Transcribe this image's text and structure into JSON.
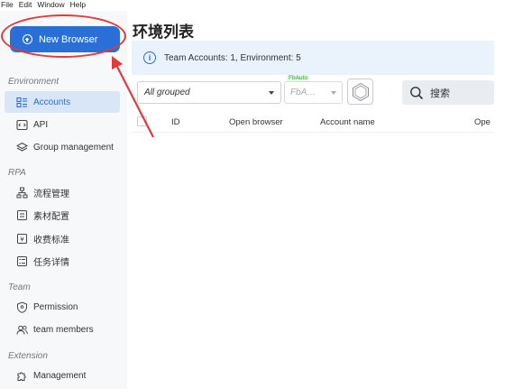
{
  "menu": [
    "File",
    "Edit",
    "Window",
    "Help"
  ],
  "new_browser": "New Browser",
  "sidebar": {
    "environment_label": "Environment",
    "rpa_label": "RPA",
    "team_label": "Team",
    "extension_label": "Extension",
    "items": {
      "accounts": "Accounts",
      "api": "API",
      "group_management": "Group management",
      "process": "流程管理",
      "material": "素材配置",
      "fee": "收费标准",
      "task": "任务详情",
      "permission": "Permission",
      "team_members": "team members",
      "management": "Management"
    }
  },
  "main": {
    "title": "环境列表",
    "info": "Team Accounts: 1, Environment: 5",
    "group_select": "All grouped",
    "fb_select": "FbA…",
    "fb_tag": "FbAuto",
    "rpa": "RPA",
    "search": "搜索",
    "columns": [
      "ID",
      "Open browser",
      "Account name",
      "Ope"
    ]
  },
  "colors": {
    "accent": "#2a6fd8",
    "annotation": "#e03a3a",
    "active_bg": "#d9e6f7"
  }
}
